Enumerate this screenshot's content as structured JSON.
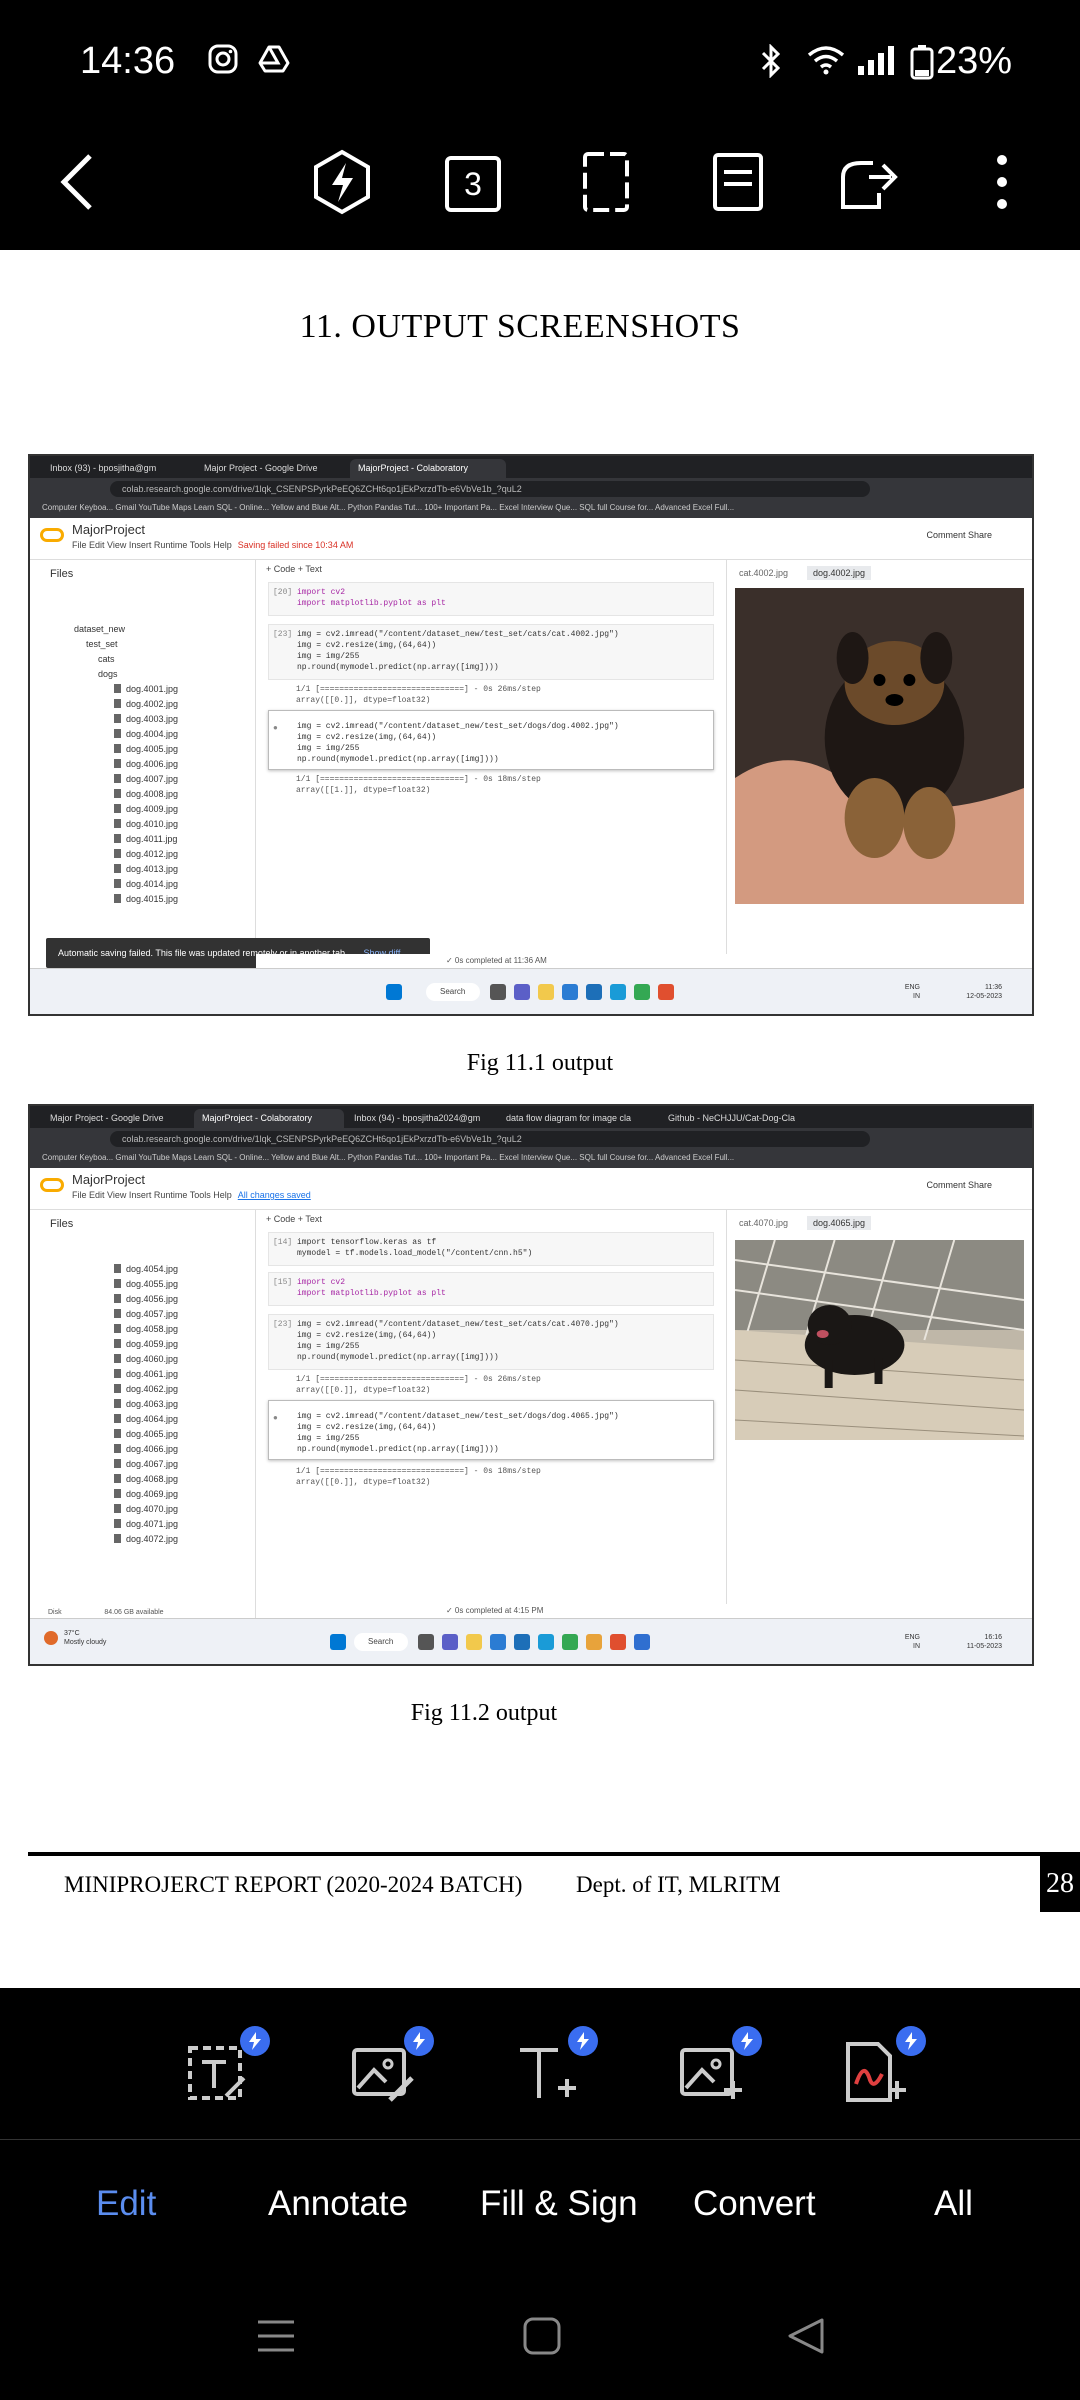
{
  "status_bar": {
    "time": "14:36",
    "battery": "23%",
    "icons": [
      "instagram-icon",
      "drive-icon",
      "bluetooth-icon",
      "wifi-icon",
      "signal-icon",
      "battery-icon"
    ]
  },
  "toolbar": {
    "back": "back-arrow-icon",
    "flash": "lightning-icon",
    "page_count": "3",
    "fullscreen": "fullscreen-icon",
    "reader": "reader-mode-icon",
    "share": "share-icon",
    "more": "more-vertical-icon"
  },
  "document": {
    "heading": "11. OUTPUT SCREENSHOTS",
    "caption1": "Fig 11.1 output",
    "caption2": "Fig 11.2 output",
    "footer_left": "MINIPROJERCT REPORT (2020-2024 BATCH)",
    "footer_dept": "Dept. of IT, MLRITM",
    "page_number": "28"
  },
  "shot1": {
    "tabs": [
      "Inbox (93) - bposjitha@gm",
      "Major Project - Google Drive",
      "MajorProject - Colaboratory"
    ],
    "url": "colab.research.google.com/drive/1lqk_CSENPSPyrkPeEQ6ZCHt6qo1jEkPxrzdTb-e6VbVe1b_?quL2",
    "bookmarks": "Computer Keyboa...   Gmail   YouTube   Maps   Learn SQL - Online...   Yellow and Blue Alt...   Python Pandas Tut...   100+ Important Pa...   Excel Interview Que...   SQL full Course for...   Advanced Excel Full...",
    "project": "MajorProject",
    "menus": "File  Edit  View  Insert  Runtime  Tools  Help",
    "save_status": "Saving failed since 10:34 AM",
    "actions": "Comment    Share",
    "files_title": "Files",
    "tree": [
      "dataset_new",
      "test_set",
      "cats",
      "dogs"
    ],
    "files": [
      "dog.4001.jpg",
      "dog.4002.jpg",
      "dog.4003.jpg",
      "dog.4004.jpg",
      "dog.4005.jpg",
      "dog.4006.jpg",
      "dog.4007.jpg",
      "dog.4008.jpg",
      "dog.4009.jpg",
      "dog.4010.jpg",
      "dog.4011.jpg",
      "dog.4012.jpg",
      "dog.4013.jpg",
      "dog.4014.jpg",
      "dog.4015.jpg"
    ],
    "addbar": "+ Code   + Text",
    "cell20_num": "[20]",
    "cell20_code": "import cv2\nimport matplotlib.pyplot as plt",
    "cell23_num": "[23]",
    "cell23_code": "img = cv2.imread(\"/content/dataset_new/test_set/cats/cat.4002.jpg\")\nimg = cv2.resize(img,(64,64))\nimg = img/255\nnp.round(mymodel.predict(np.array([img])))",
    "out23": "1/1 [==============================] - 0s 26ms/step\narray([[0.]], dtype=float32)",
    "cell24_code": "img = cv2.imread(\"/content/dataset_new/test_set/dogs/dog.4002.jpg\")\nimg = cv2.resize(img,(64,64))\nimg = img/255\nnp.round(mymodel.predict(np.array([img])))",
    "out24": "1/1 [==============================] - 0s 18ms/step\narray([[1.]], dtype=float32)",
    "viewer_tabs": [
      "cat.4002.jpg",
      "dog.4002.jpg"
    ],
    "toast": "Automatic saving failed. This file was updated remotely or in another tab.",
    "toast_link": "Show diff",
    "completed": "✓ 0s   completed at 11:36 AM",
    "tray_lang": "ENG\nIN",
    "tray_time": "11:36\n12-05-2023",
    "search": "Search"
  },
  "shot2": {
    "tabs": [
      "Major Project - Google Drive",
      "MajorProject - Colaboratory",
      "Inbox (94) - bposjitha2024@gm",
      "data flow diagram for image cla",
      "Github - NeCHJJU/Cat-Dog-Cla"
    ],
    "url": "colab.research.google.com/drive/1lqk_CSENPSPyrkPeEQ6ZCHt6qo1jEkPxrzdTb-e6VbVe1b_?quL2",
    "bookmarks": "Computer Keyboa...   Gmail   YouTube   Maps   Learn SQL - Online...   Yellow and Blue Alt...   Python Pandas Tut...   100+ Important Pa...   Excel Interview Que...   SQL full Course for...   Advanced Excel Full...",
    "project": "MajorProject",
    "menus": "File  Edit  View  Insert  Runtime  Tools  Help",
    "save_status": "All changes saved",
    "actions": "Comment    Share",
    "files_title": "Files",
    "files": [
      "dog.4054.jpg",
      "dog.4055.jpg",
      "dog.4056.jpg",
      "dog.4057.jpg",
      "dog.4058.jpg",
      "dog.4059.jpg",
      "dog.4060.jpg",
      "dog.4061.jpg",
      "dog.4062.jpg",
      "dog.4063.jpg",
      "dog.4064.jpg",
      "dog.4065.jpg",
      "dog.4066.jpg",
      "dog.4067.jpg",
      "dog.4068.jpg",
      "dog.4069.jpg",
      "dog.4070.jpg",
      "dog.4071.jpg",
      "dog.4072.jpg"
    ],
    "disk": "Disk                      84.06 GB available",
    "addbar": "+ Code   + Text",
    "cell14_num": "[14]",
    "cell14_code": "import tensorflow.keras as tf\nmymodel = tf.models.load_model(\"/content/cnn.h5\")",
    "cell15_num": "[15]",
    "cell15_code": "import cv2\nimport matplotlib.pyplot as plt",
    "cell23_num": "[23]",
    "cell23_code": "img = cv2.imread(\"/content/dataset_new/test_set/cats/cat.4070.jpg\")\nimg = cv2.resize(img,(64,64))\nimg = img/255\nnp.round(mymodel.predict(np.array([img])))",
    "out23": "1/1 [==============================] - 0s 26ms/step\narray([[0.]], dtype=float32)",
    "cell24_code": "img = cv2.imread(\"/content/dataset_new/test_set/dogs/dog.4065.jpg\")\nimg = cv2.resize(img,(64,64))\nimg = img/255\nnp.round(mymodel.predict(np.array([img])))",
    "out24": "1/1 [==============================] - 0s 18ms/step\narray([[0.]], dtype=float32)",
    "viewer_tabs": [
      "cat.4070.jpg",
      "dog.4065.jpg"
    ],
    "completed": "✓ 0s   completed at 4:15 PM",
    "weather": "37°C\nMostly cloudy",
    "tray_lang": "ENG\nIN",
    "tray_time": "16:16\n11-05-2023",
    "search": "Search"
  },
  "bottom_tools": [
    "edit-text-icon",
    "edit-image-icon",
    "add-text-icon",
    "add-image-icon",
    "sign-document-icon"
  ],
  "tabs": {
    "edit": "Edit",
    "annotate": "Annotate",
    "fill_sign": "Fill & Sign",
    "convert": "Convert",
    "all": "All",
    "active_color": "#5b8def"
  },
  "nav": [
    "recent-apps-icon",
    "home-icon",
    "back-icon"
  ]
}
